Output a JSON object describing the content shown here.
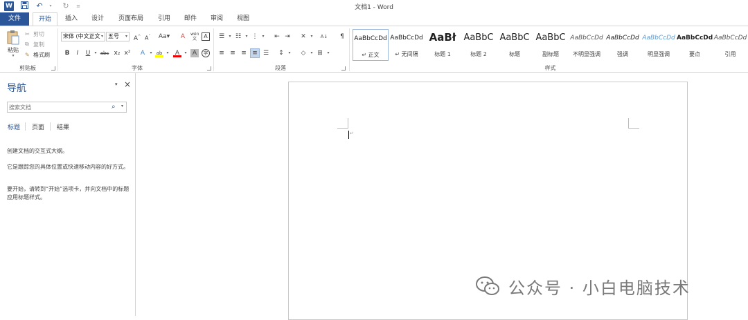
{
  "window": {
    "title": "文档1 - Word",
    "app_icon": "W",
    "qat": [
      "save-icon",
      "undo-icon",
      "redo-icon",
      "customize-icon"
    ]
  },
  "tabs": [
    "文件",
    "开始",
    "插入",
    "设计",
    "页面布局",
    "引用",
    "邮件",
    "审阅",
    "视图"
  ],
  "active_tab": "开始",
  "ribbon": {
    "clipboard": {
      "label": "剪贴板",
      "paste": "粘贴",
      "cut": "剪切",
      "copy": "复制",
      "format_painter": "格式刷"
    },
    "font": {
      "label": "字体",
      "font_name": "宋体 (中文正文",
      "font_size": "五号",
      "buttons": [
        "B",
        "I",
        "U",
        "abc",
        "x₂",
        "x²"
      ]
    },
    "paragraph": {
      "label": "段落"
    },
    "styles": {
      "label": "样式",
      "items": [
        {
          "preview": "AaBbCcDd",
          "name": "↵ 正文"
        },
        {
          "preview": "AaBbCcDd",
          "name": "↵ 无间隔"
        },
        {
          "preview": "AaBł",
          "name": "标题 1"
        },
        {
          "preview": "AaBbC",
          "name": "标题 2"
        },
        {
          "preview": "AaBbC",
          "name": "标题"
        },
        {
          "preview": "AaBbC",
          "name": "副标题"
        },
        {
          "preview": "AaBbCcDd",
          "name": "不明显强调"
        },
        {
          "preview": "AaBbCcDd",
          "name": "强调"
        },
        {
          "preview": "AaBbCcDd",
          "name": "明显强调"
        },
        {
          "preview": "AaBbCcDd",
          "name": "要点"
        },
        {
          "preview": "AaBbCcDd",
          "name": "引用"
        }
      ]
    }
  },
  "nav_pane": {
    "title": "导航",
    "search_placeholder": "搜索文档",
    "tabs": [
      "标题",
      "页面",
      "结果"
    ],
    "messages": [
      "创建文档的交互式大纲。",
      "它是跟踪您的具体位置或快速移动内容的好方式。",
      "要开始，请转到“开始”选项卡，并向文档中的标题应用标题样式。"
    ]
  },
  "watermark": "公众号 · 小白电脑技术",
  "colors": {
    "accent": "#2b579a",
    "border": "#d4d4d4",
    "canvas": "#ffffff"
  }
}
